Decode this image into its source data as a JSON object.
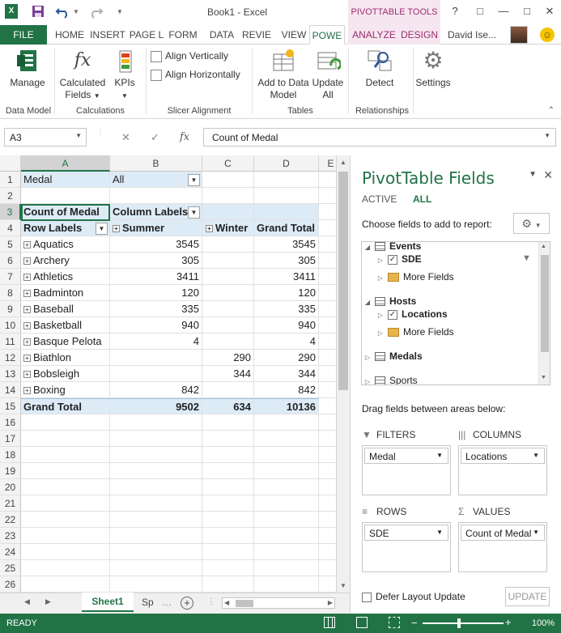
{
  "window": {
    "title": "Book1 - Excel",
    "tools_context": "PIVOTTABLE TOOLS",
    "controls": [
      "?",
      "□",
      "—",
      "□",
      "✕"
    ]
  },
  "tabs": [
    "FILE",
    "HOME",
    "INSERT",
    "PAGE L",
    "FORM",
    "DATA",
    "REVIE",
    "VIEW",
    "POWE",
    "ANALYZE",
    "DESIGN"
  ],
  "user": {
    "name": "David Ise..."
  },
  "ribbon": {
    "manage": "Manage",
    "calculated_fields": "Calculated Fields",
    "kpis": "KPIs",
    "align_vertically": "Align Vertically",
    "align_horizontally": "Align Horizontally",
    "add_to_data_model": "Add to Data Model",
    "update_all": "Update All",
    "detect": "Detect",
    "settings": "Settings",
    "groups": {
      "data_model": "Data Model",
      "calculations": "Calculations",
      "slicer_alignment": "Slicer Alignment",
      "tables": "Tables",
      "relationships": "Relationships"
    }
  },
  "formula_bar": {
    "name_box": "A3",
    "cancel": "✕",
    "enter": "✓",
    "fx": "fx",
    "content": "Count of Medal"
  },
  "grid": {
    "columns": [
      "A",
      "B",
      "C",
      "D",
      "E"
    ],
    "row_numbers": [
      "1",
      "2",
      "3",
      "4",
      "5",
      "6",
      "7",
      "8",
      "9",
      "10",
      "11",
      "12",
      "13",
      "14",
      "15",
      "16",
      "17",
      "18",
      "19",
      "20",
      "21",
      "22",
      "23",
      "24",
      "25",
      "26"
    ],
    "filter": {
      "label": "Medal",
      "value": "All"
    },
    "header": {
      "count": "Count of Medal",
      "column_labels": "Column Labels"
    },
    "subheader": {
      "row_labels": "Row Labels",
      "summer": "Summer",
      "winter": "Winter",
      "grand_total": "Grand Total"
    },
    "rows": [
      {
        "label": "Aquatics",
        "summer": "3545",
        "winter": "",
        "total": "3545"
      },
      {
        "label": "Archery",
        "summer": "305",
        "winter": "",
        "total": "305"
      },
      {
        "label": "Athletics",
        "summer": "3411",
        "winter": "",
        "total": "3411"
      },
      {
        "label": "Badminton",
        "summer": "120",
        "winter": "",
        "total": "120"
      },
      {
        "label": "Baseball",
        "summer": "335",
        "winter": "",
        "total": "335"
      },
      {
        "label": "Basketball",
        "summer": "940",
        "winter": "",
        "total": "940"
      },
      {
        "label": "Basque Pelota",
        "summer": "4",
        "winter": "",
        "total": "4"
      },
      {
        "label": "Biathlon",
        "summer": "",
        "winter": "290",
        "total": "290"
      },
      {
        "label": "Bobsleigh",
        "summer": "",
        "winter": "344",
        "total": "344"
      },
      {
        "label": "Boxing",
        "summer": "842",
        "winter": "",
        "total": "842"
      }
    ],
    "grand_total": {
      "label": "Grand Total",
      "summer": "9502",
      "winter": "634",
      "total": "10136"
    }
  },
  "sheets": {
    "active": "Sheet1",
    "other": "Sp"
  },
  "status": {
    "text": "READY",
    "zoom": "100%",
    "zoom_level": 1.0
  },
  "pane": {
    "title": "PivotTable Fields",
    "tab_active": "ACTIVE",
    "tab_all": "ALL",
    "choose_label": "Choose fields to add to report:",
    "fields": {
      "events": "Events",
      "sde": "SDE",
      "more_fields_1": "More Fields",
      "hosts": "Hosts",
      "locations": "Locations",
      "more_fields_2": "More Fields",
      "medals": "Medals",
      "sports": "Sports"
    },
    "drag_label": "Drag fields between areas below:",
    "areas": {
      "filters": {
        "title": "FILTERS",
        "value": "Medal"
      },
      "columns": {
        "title": "COLUMNS",
        "value": "Locations"
      },
      "rows": {
        "title": "ROWS",
        "value": "SDE"
      },
      "values": {
        "title": "VALUES",
        "value": "Count of Medal"
      }
    },
    "defer_label": "Defer Layout Update",
    "update_label": "UPDATE"
  },
  "colors": {
    "excel_green": "#217346",
    "pivot_tools": "#9b2e6f",
    "pivot_fill": "#ddebf7"
  }
}
